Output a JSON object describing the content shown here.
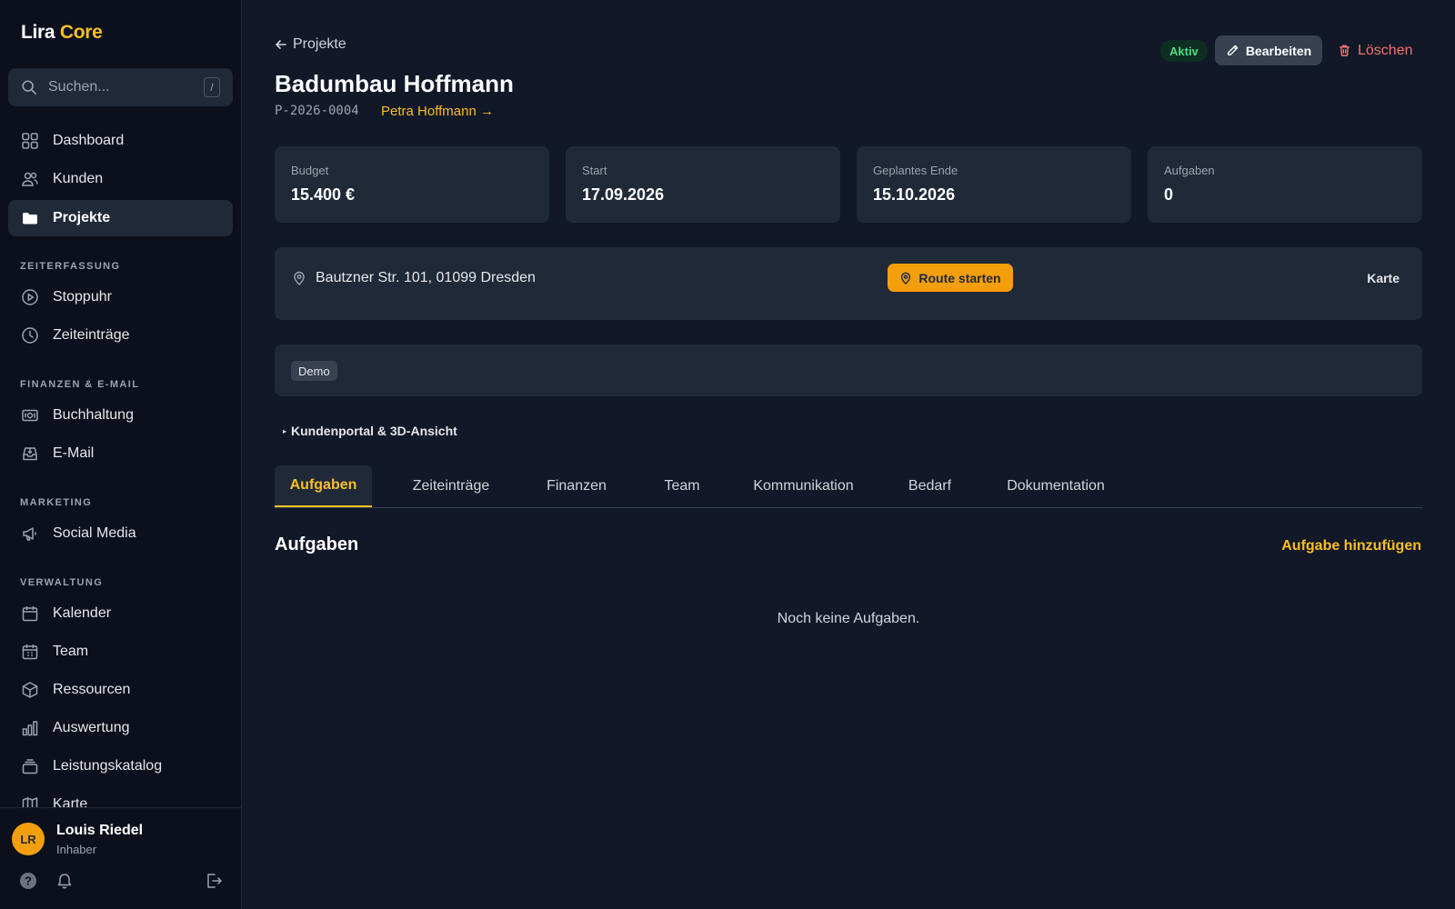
{
  "app": {
    "logo_primary": "Lira",
    "logo_accent": "Core",
    "accent_color": "#fbbf24"
  },
  "sidebar": {
    "search": {
      "placeholder": "Suchen...",
      "shortcut": "/"
    },
    "items": [
      {
        "label": "Dashboard",
        "icon": "grid-icon"
      },
      {
        "label": "Kunden",
        "icon": "users-icon"
      },
      {
        "label": "Projekte",
        "icon": "folder-icon",
        "active": true
      }
    ],
    "sections": [
      {
        "title": "ZEITERFASSUNG",
        "items": [
          {
            "label": "Stoppuhr",
            "icon": "play-circle-icon"
          },
          {
            "label": "Zeiteinträge",
            "icon": "clock-icon"
          }
        ]
      },
      {
        "title": "FINANZEN & E-MAIL",
        "items": [
          {
            "label": "Buchhaltung",
            "icon": "banknote-icon"
          },
          {
            "label": "E-Mail",
            "icon": "inbox-icon"
          }
        ]
      },
      {
        "title": "MARKETING",
        "items": [
          {
            "label": "Social Media",
            "icon": "megaphone-icon"
          }
        ]
      },
      {
        "title": "VERWALTUNG",
        "items": [
          {
            "label": "Kalender",
            "icon": "calendar-icon"
          },
          {
            "label": "Team",
            "icon": "calendar-grid-icon"
          },
          {
            "label": "Ressourcen",
            "icon": "box-icon"
          },
          {
            "label": "Auswertung",
            "icon": "bar-chart-icon"
          },
          {
            "label": "Leistungskatalog",
            "icon": "layers-icon"
          },
          {
            "label": "Karte",
            "icon": "map-icon"
          }
        ]
      }
    ],
    "user": {
      "initials": "LR",
      "name": "Louis Riedel",
      "role": "Inhaber"
    }
  },
  "project": {
    "back_label": "Projekte",
    "title": "Badumbau Hoffmann",
    "id": "P-2026-0004",
    "customer_link": "Petra Hoffmann →",
    "status": "Aktiv",
    "edit_label": "Bearbeiten",
    "delete_label": "Löschen",
    "stats": [
      {
        "label": "Budget",
        "value": "15.400 €"
      },
      {
        "label": "Start",
        "value": "17.09.2026"
      },
      {
        "label": "Geplantes Ende",
        "value": "15.10.2026"
      },
      {
        "label": "Aufgaben",
        "value": "0"
      }
    ],
    "address": "Bautzner Str. 101, 01099 Dresden",
    "route_label": "Route starten",
    "map_label": "Karte",
    "tags": [
      "Demo"
    ],
    "portal_label": "Kundenportal & 3D-Ansicht"
  },
  "tabs": [
    "Aufgaben",
    "Zeiteinträge",
    "Finanzen",
    "Team",
    "Kommunikation",
    "Bedarf",
    "Dokumentation"
  ],
  "tasks": {
    "title": "Aufgaben",
    "add_label": "Aufgabe hinzufügen",
    "empty_text": "Noch keine Aufgaben."
  }
}
